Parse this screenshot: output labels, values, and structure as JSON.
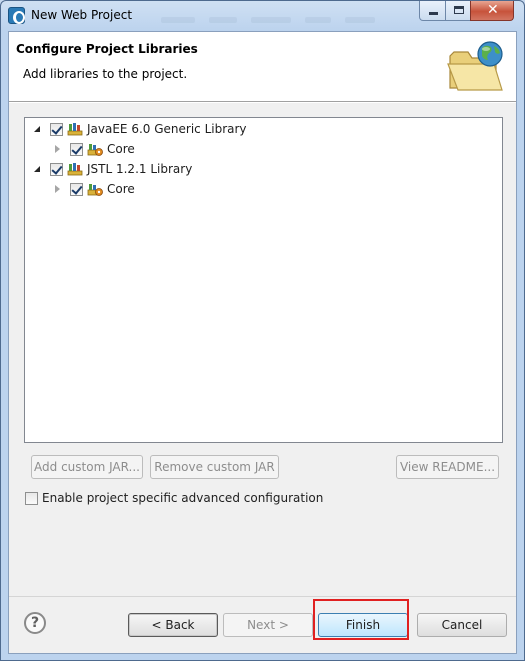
{
  "window": {
    "title": "New Web Project",
    "controls": {
      "minimize": "minimize-icon",
      "maximize": "maximize-icon",
      "close": "close-icon"
    }
  },
  "header": {
    "title": "Configure Project Libraries",
    "subtitle": "Add libraries to the project.",
    "icon": "folder-globe-icon"
  },
  "tree": {
    "nodes": [
      {
        "label": "JavaEE 6.0 Generic Library",
        "checked": true,
        "expanded": true,
        "icon": "library-icon",
        "children": [
          {
            "label": "Core",
            "checked": true,
            "expanded": false,
            "icon": "library-component-icon"
          }
        ]
      },
      {
        "label": "JSTL 1.2.1 Library",
        "checked": true,
        "expanded": true,
        "icon": "library-icon",
        "children": [
          {
            "label": "Core",
            "checked": true,
            "expanded": false,
            "icon": "library-component-icon"
          }
        ]
      }
    ]
  },
  "library_buttons": {
    "add_jar": "Add custom JAR...",
    "remove_jar": "Remove custom JAR",
    "view_readme": "View README..."
  },
  "advanced": {
    "label": "Enable project specific advanced configuration",
    "checked": false
  },
  "footer": {
    "help_glyph": "?",
    "back": "< Back",
    "next": "Next >",
    "finish": "Finish",
    "cancel": "Cancel"
  },
  "colors": {
    "highlight": "#e02020",
    "titlebar": "#bcd3ee",
    "close_button": "#c7533b"
  }
}
